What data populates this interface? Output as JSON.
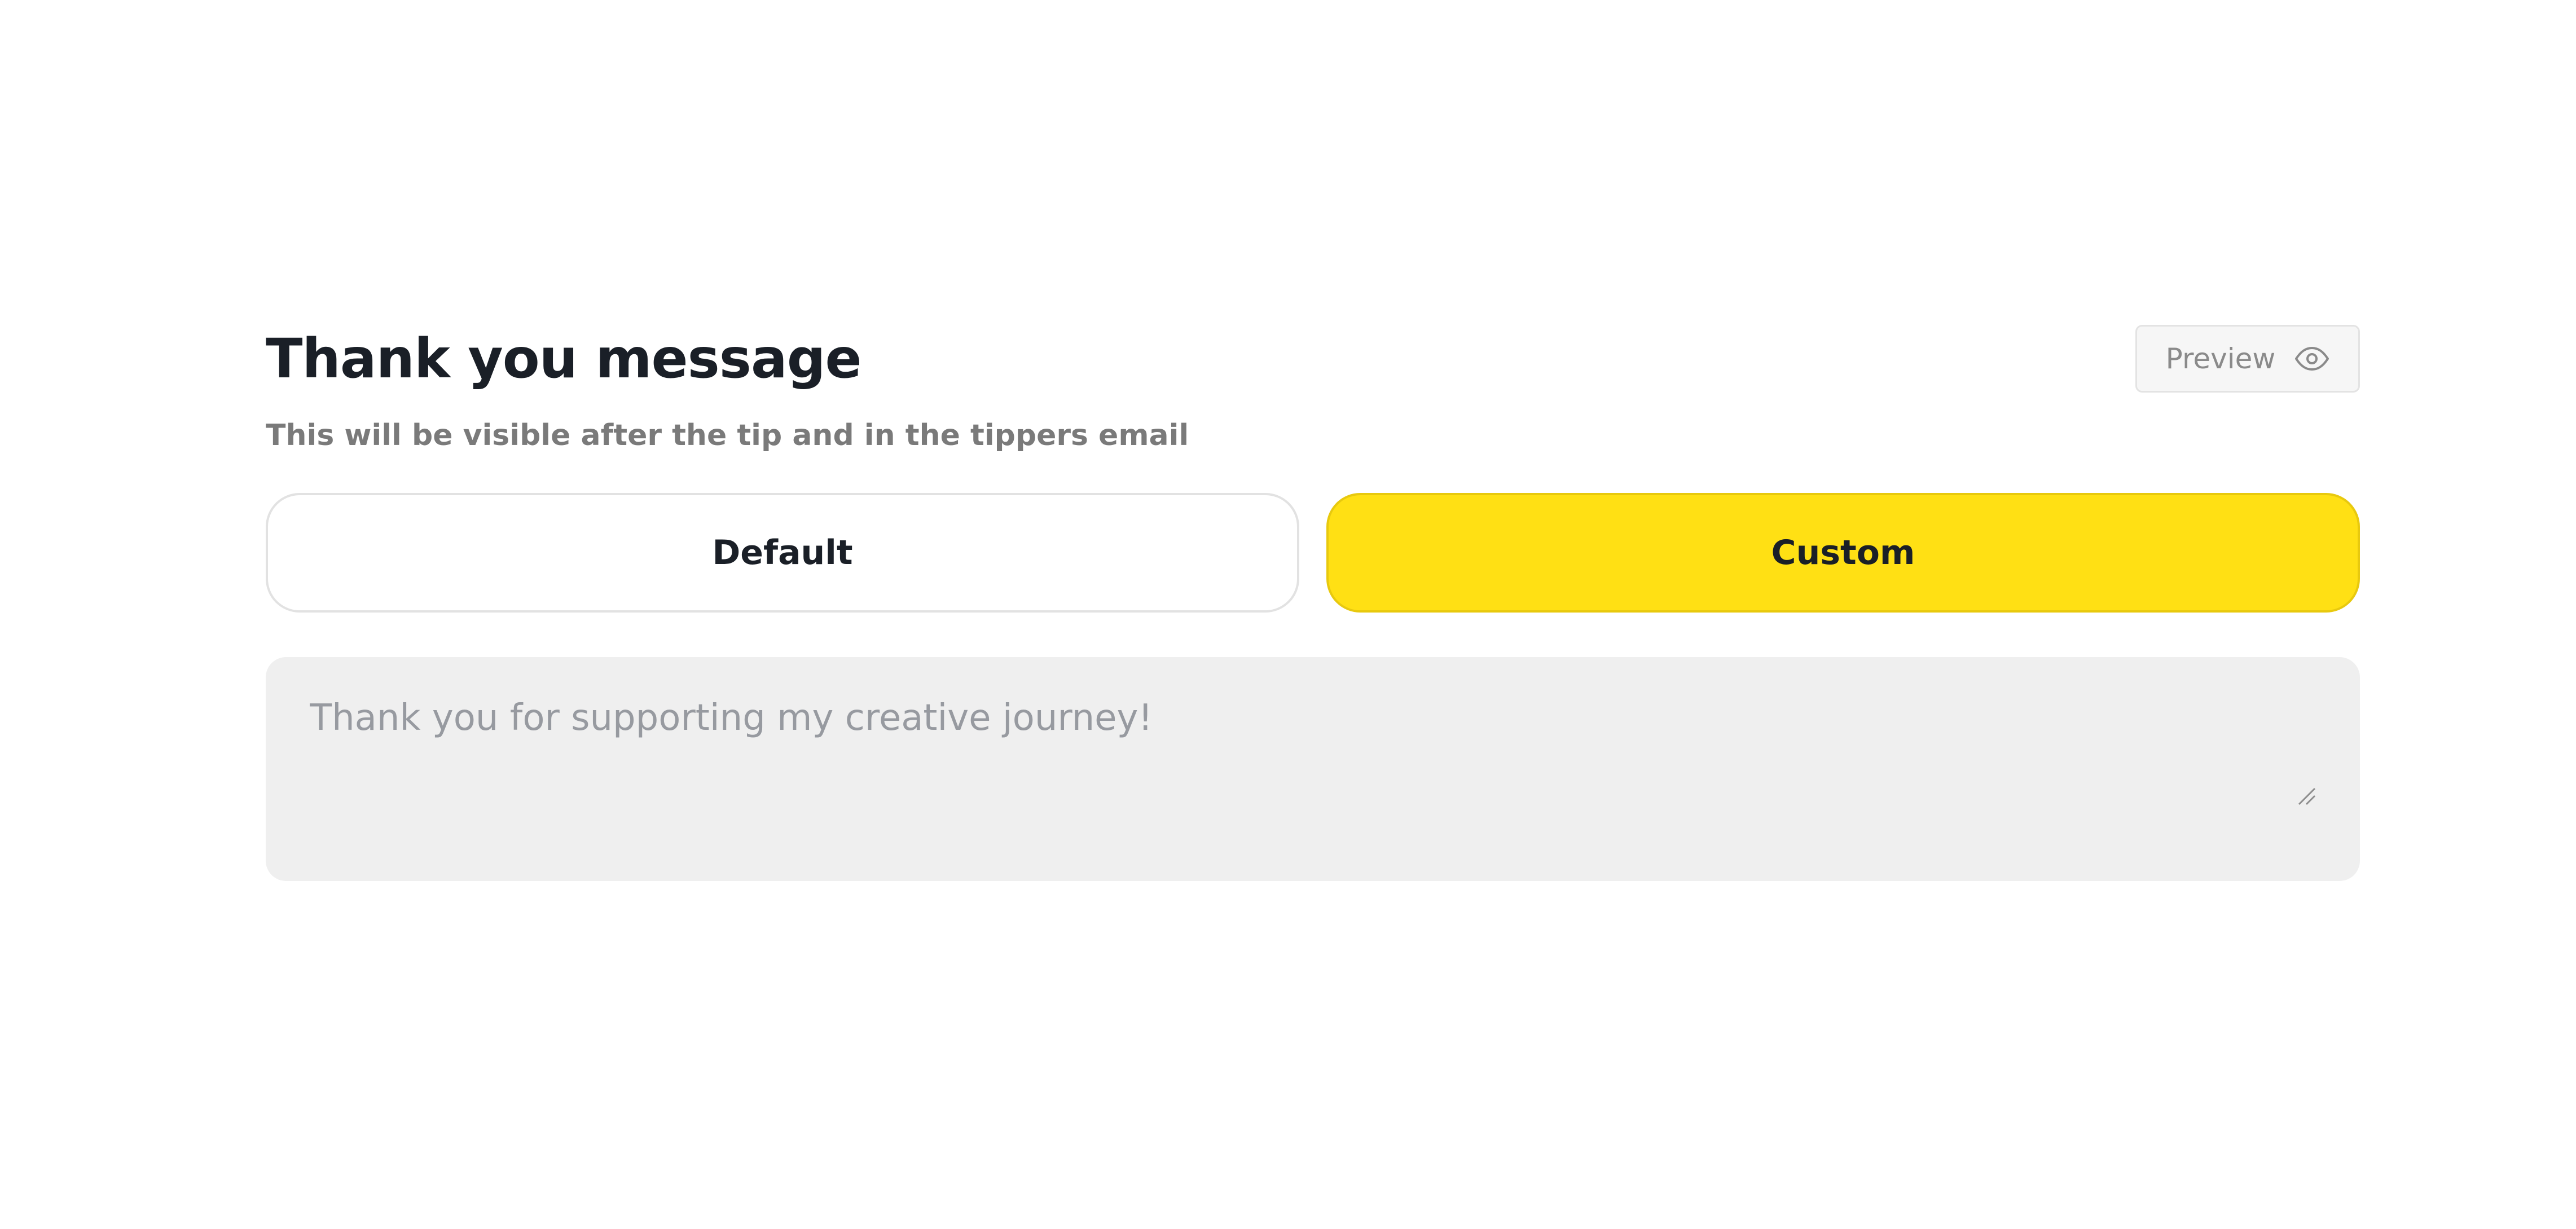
{
  "header": {
    "title": "Thank you message",
    "subtitle": "This will be visible after the tip and in the tippers email",
    "preview_label": "Preview",
    "preview_icon": "eye-icon"
  },
  "mode_toggle": {
    "options": [
      {
        "label": "Default",
        "selected": false
      },
      {
        "label": "Custom",
        "selected": true
      }
    ]
  },
  "message": {
    "placeholder": "Thank you for supporting my creative journey!",
    "value": ""
  },
  "colors": {
    "accent": "#ffe014",
    "title": "#1a1f27",
    "subtitle": "#7a7a7a",
    "input_background": "#efefef"
  }
}
